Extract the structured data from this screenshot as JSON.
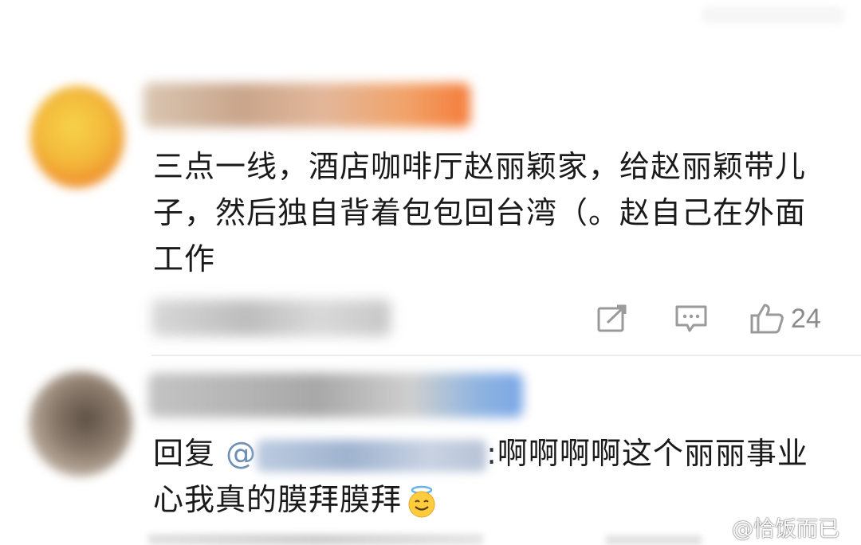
{
  "comments": [
    {
      "text": "三点一线，酒店咖啡厅赵丽颖家，给赵丽颖带儿子，然后独自背着包包回台湾（。赵自己在外面工作",
      "actions": {
        "share_icon": "share-icon",
        "comment_icon": "comment-icon",
        "like_icon": "thumbs-up-icon",
        "like_count": "24"
      }
    },
    {
      "reply_prefix": "回复",
      "mention_at": "@",
      "reply_text": ":啊啊啊啊这个丽丽事业心我真的膜拜膜拜",
      "emoji": "smiling-face-with-halo-emoji"
    }
  ],
  "watermark": {
    "text": "@恰饭而已",
    "icon": "weibo-logo-icon"
  },
  "colors": {
    "background": "#ffffff",
    "text": "#1a1a1a",
    "muted": "#8a8a8a",
    "mention": "#6f8fb6"
  }
}
